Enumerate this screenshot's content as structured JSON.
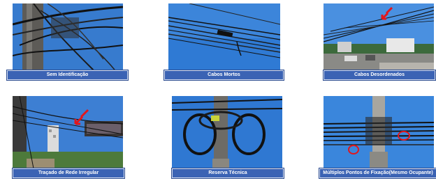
{
  "photos": [
    {
      "caption": "Sem Identificação"
    },
    {
      "caption": "Cabos Mortos"
    },
    {
      "caption": "Cabos Desordenados"
    },
    {
      "caption": "Traçado de Rede Irregular"
    },
    {
      "caption": "Reserva Técnica"
    },
    {
      "caption": "Múltiplos Pontos de Fixação(Mesmo Ocupante)"
    }
  ],
  "colors": {
    "caption_bg": "#3b63b4",
    "sky": "#3f86d6",
    "marker": "#e3161b"
  }
}
